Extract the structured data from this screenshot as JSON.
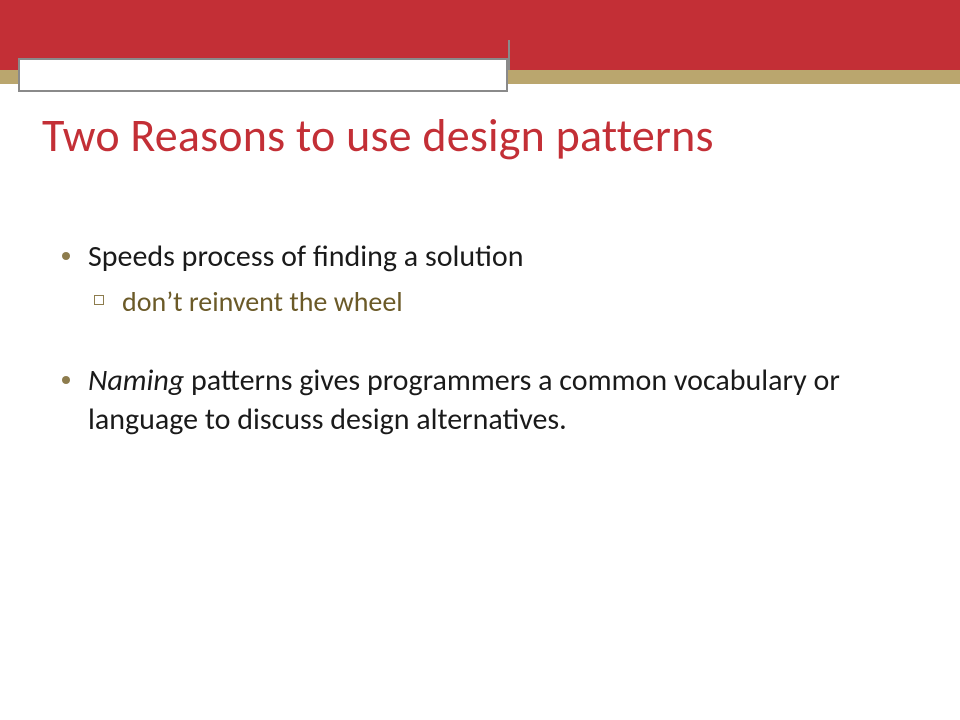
{
  "title": "Two Reasons to use design patterns",
  "bullets": [
    {
      "text": "Speeds process of finding a solution",
      "sub": [
        "don’t reinvent the wheel"
      ]
    },
    {
      "lead_italic": "Naming",
      "rest": " patterns gives programmers a common vocabulary  or language to discuss design alternatives."
    }
  ]
}
